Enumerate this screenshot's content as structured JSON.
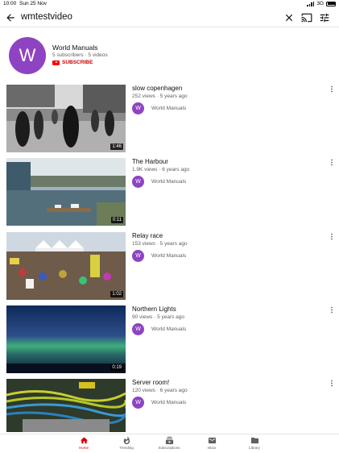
{
  "status_bar": {
    "time": "10:00",
    "date": "Sun 25 Nov",
    "network": "3G"
  },
  "search": {
    "query": "wmtestvideo"
  },
  "channel": {
    "avatar_letter": "W",
    "name": "World Manuals",
    "stats": "5 subscribers · 5 videos",
    "subscribe_label": "SUBSCRIBE"
  },
  "videos": [
    {
      "title": "slow copenhagen",
      "meta": "252 views · 5 years ago",
      "channel": "World Manuals",
      "avatar_letter": "W",
      "duration": "1:46"
    },
    {
      "title": "The Harbour",
      "meta": "1.9K views · 6 years ago",
      "channel": "World Manuals",
      "avatar_letter": "W",
      "duration": "0:11"
    },
    {
      "title": "Relay race",
      "meta": "153 views · 5 years ago",
      "channel": "World Manuals",
      "avatar_letter": "W",
      "duration": "1:02"
    },
    {
      "title": "Northern Lights",
      "meta": "90 views · 5 years ago",
      "channel": "World Manuals",
      "avatar_letter": "W",
      "duration": "0:19"
    },
    {
      "title": "Server room!",
      "meta": "120 views · 6 years ago",
      "channel": "World Manuals",
      "avatar_letter": "W",
      "duration": ""
    }
  ],
  "bottom_nav": [
    {
      "label": "Home",
      "icon": "home-icon",
      "active": true
    },
    {
      "label": "Trending",
      "icon": "flame-icon",
      "active": false
    },
    {
      "label": "Subscriptions",
      "icon": "subscriptions-icon",
      "active": false
    },
    {
      "label": "Inbox",
      "icon": "mail-icon",
      "active": false
    },
    {
      "label": "Library",
      "icon": "folder-icon",
      "active": false
    }
  ],
  "colors": {
    "accent": "#cc0000",
    "avatar": "#8e44c2",
    "text_secondary": "#606060"
  }
}
